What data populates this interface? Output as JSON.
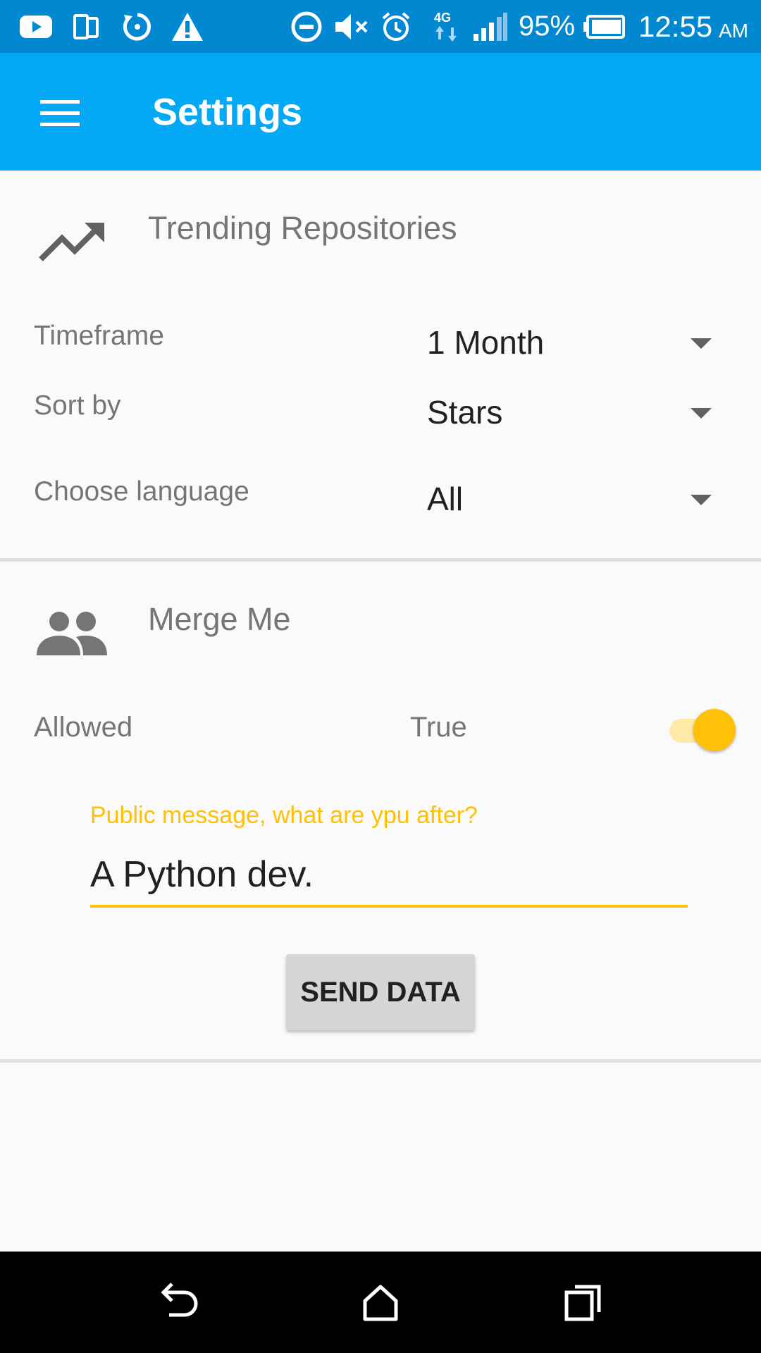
{
  "status_bar": {
    "battery_percent": "95%",
    "time": "12:55",
    "ampm": "AM",
    "network": "4G",
    "icons": [
      "youtube-icon",
      "dual-screen-icon",
      "sync-icon",
      "warning-icon",
      "do-not-disturb-icon",
      "mute-icon",
      "alarm-icon",
      "4g-icon",
      "signal-icon",
      "battery-icon"
    ]
  },
  "app_bar": {
    "title": "Settings",
    "menu_icon": "menu-icon"
  },
  "trending": {
    "title": "Trending Repositories",
    "icon": "trending-up-icon",
    "rows": [
      {
        "label": "Timeframe",
        "value": "1 Month"
      },
      {
        "label": "Sort by",
        "value": "Stars"
      },
      {
        "label": "Choose language",
        "value": "All"
      }
    ]
  },
  "merge": {
    "title": "Merge Me",
    "icon": "people-icon",
    "allowed_label": "Allowed",
    "allowed_value": "True",
    "switch_on": true,
    "message_label": "Public message, what are ypu after?",
    "message_value": "A Python dev.",
    "send_button": "SEND DATA"
  },
  "colors": {
    "status_bar": "#0288d1",
    "app_bar": "#03a9f4",
    "accent": "#ffc107"
  },
  "nav_bar": {
    "icons": [
      "back-icon",
      "home-icon",
      "recents-icon"
    ]
  }
}
